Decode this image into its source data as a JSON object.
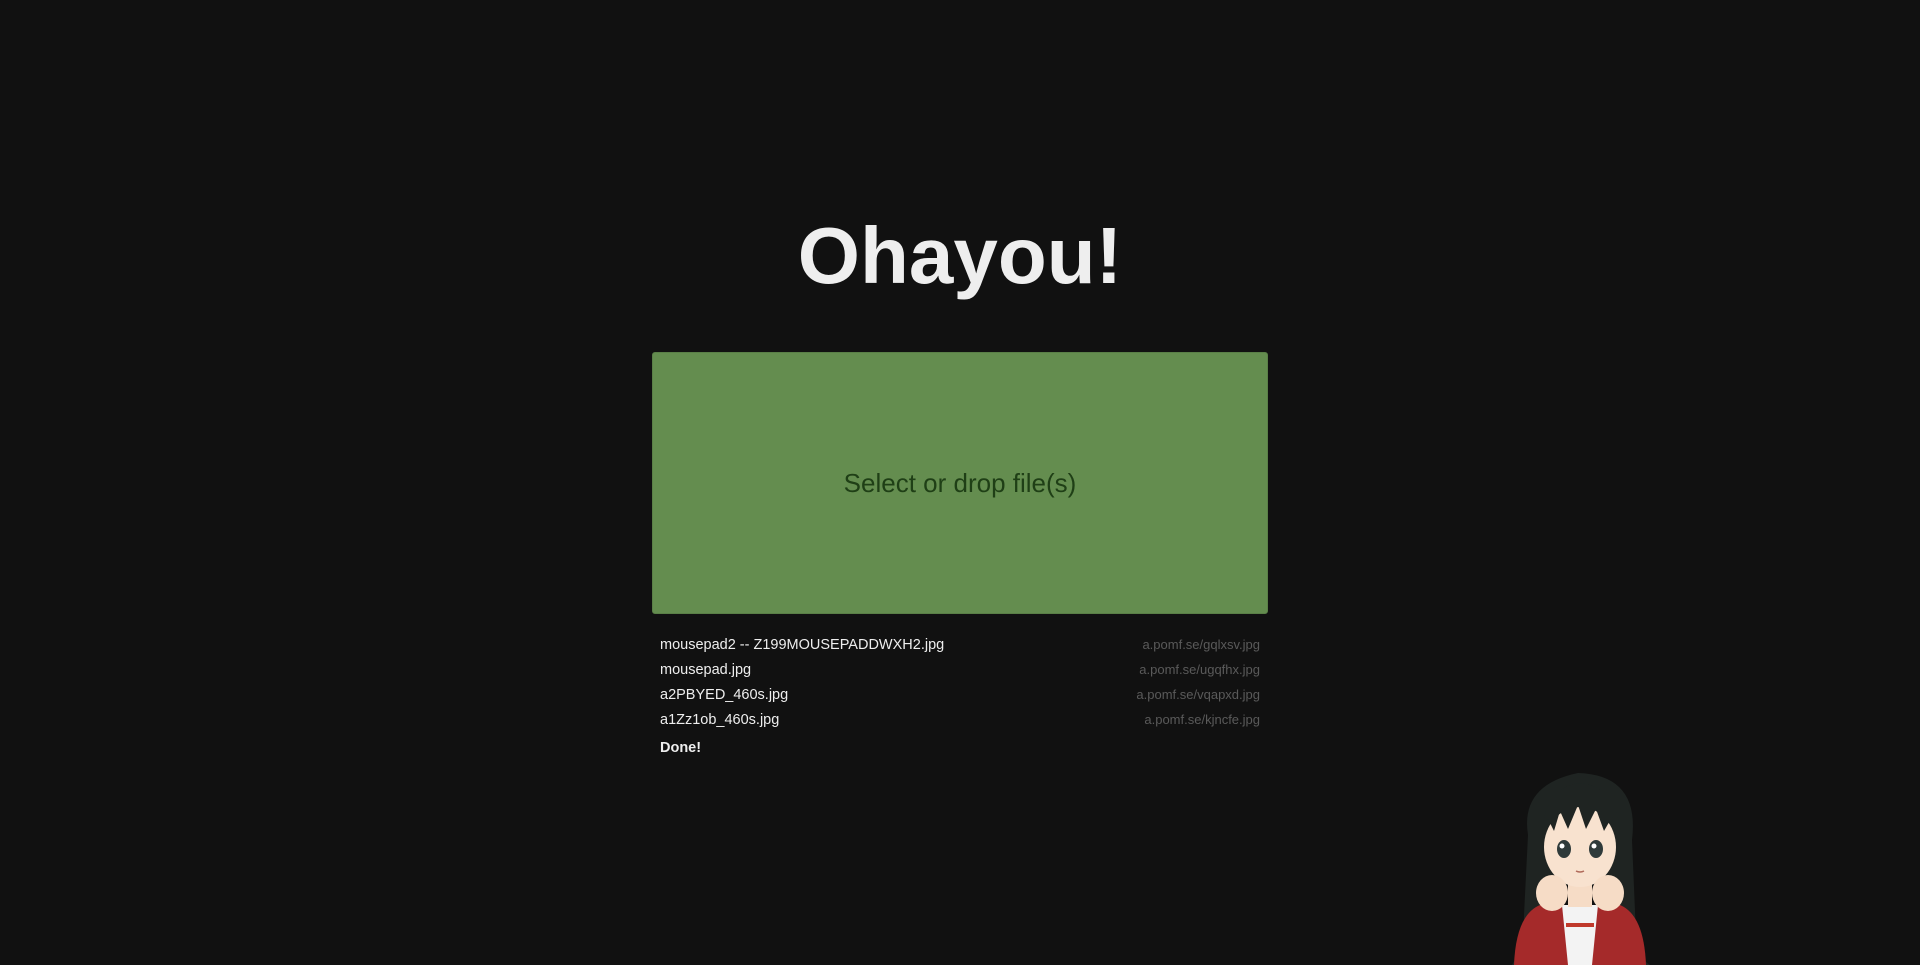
{
  "header": {
    "title": "Ohayou!"
  },
  "upload": {
    "label": "Select or drop file(s)"
  },
  "files": [
    {
      "name": "mousepad2 -- Z199MOUSEPADDWXH2.jpg",
      "url": "a.pomf.se/gqlxsv.jpg"
    },
    {
      "name": "mousepad.jpg",
      "url": "a.pomf.se/ugqfhx.jpg"
    },
    {
      "name": "a2PBYED_460s.jpg",
      "url": "a.pomf.se/vqapxd.jpg"
    },
    {
      "name": "a1Zz1ob_460s.jpg",
      "url": "a.pomf.se/kjncfe.jpg"
    }
  ],
  "status": "Done!",
  "colors": {
    "background": "#111111",
    "dropzone": "#648d4f",
    "dropzone_text": "#1f3f16",
    "link": "#5a5a5a"
  },
  "mascot": {
    "icon": "anime-girl-mascot"
  }
}
